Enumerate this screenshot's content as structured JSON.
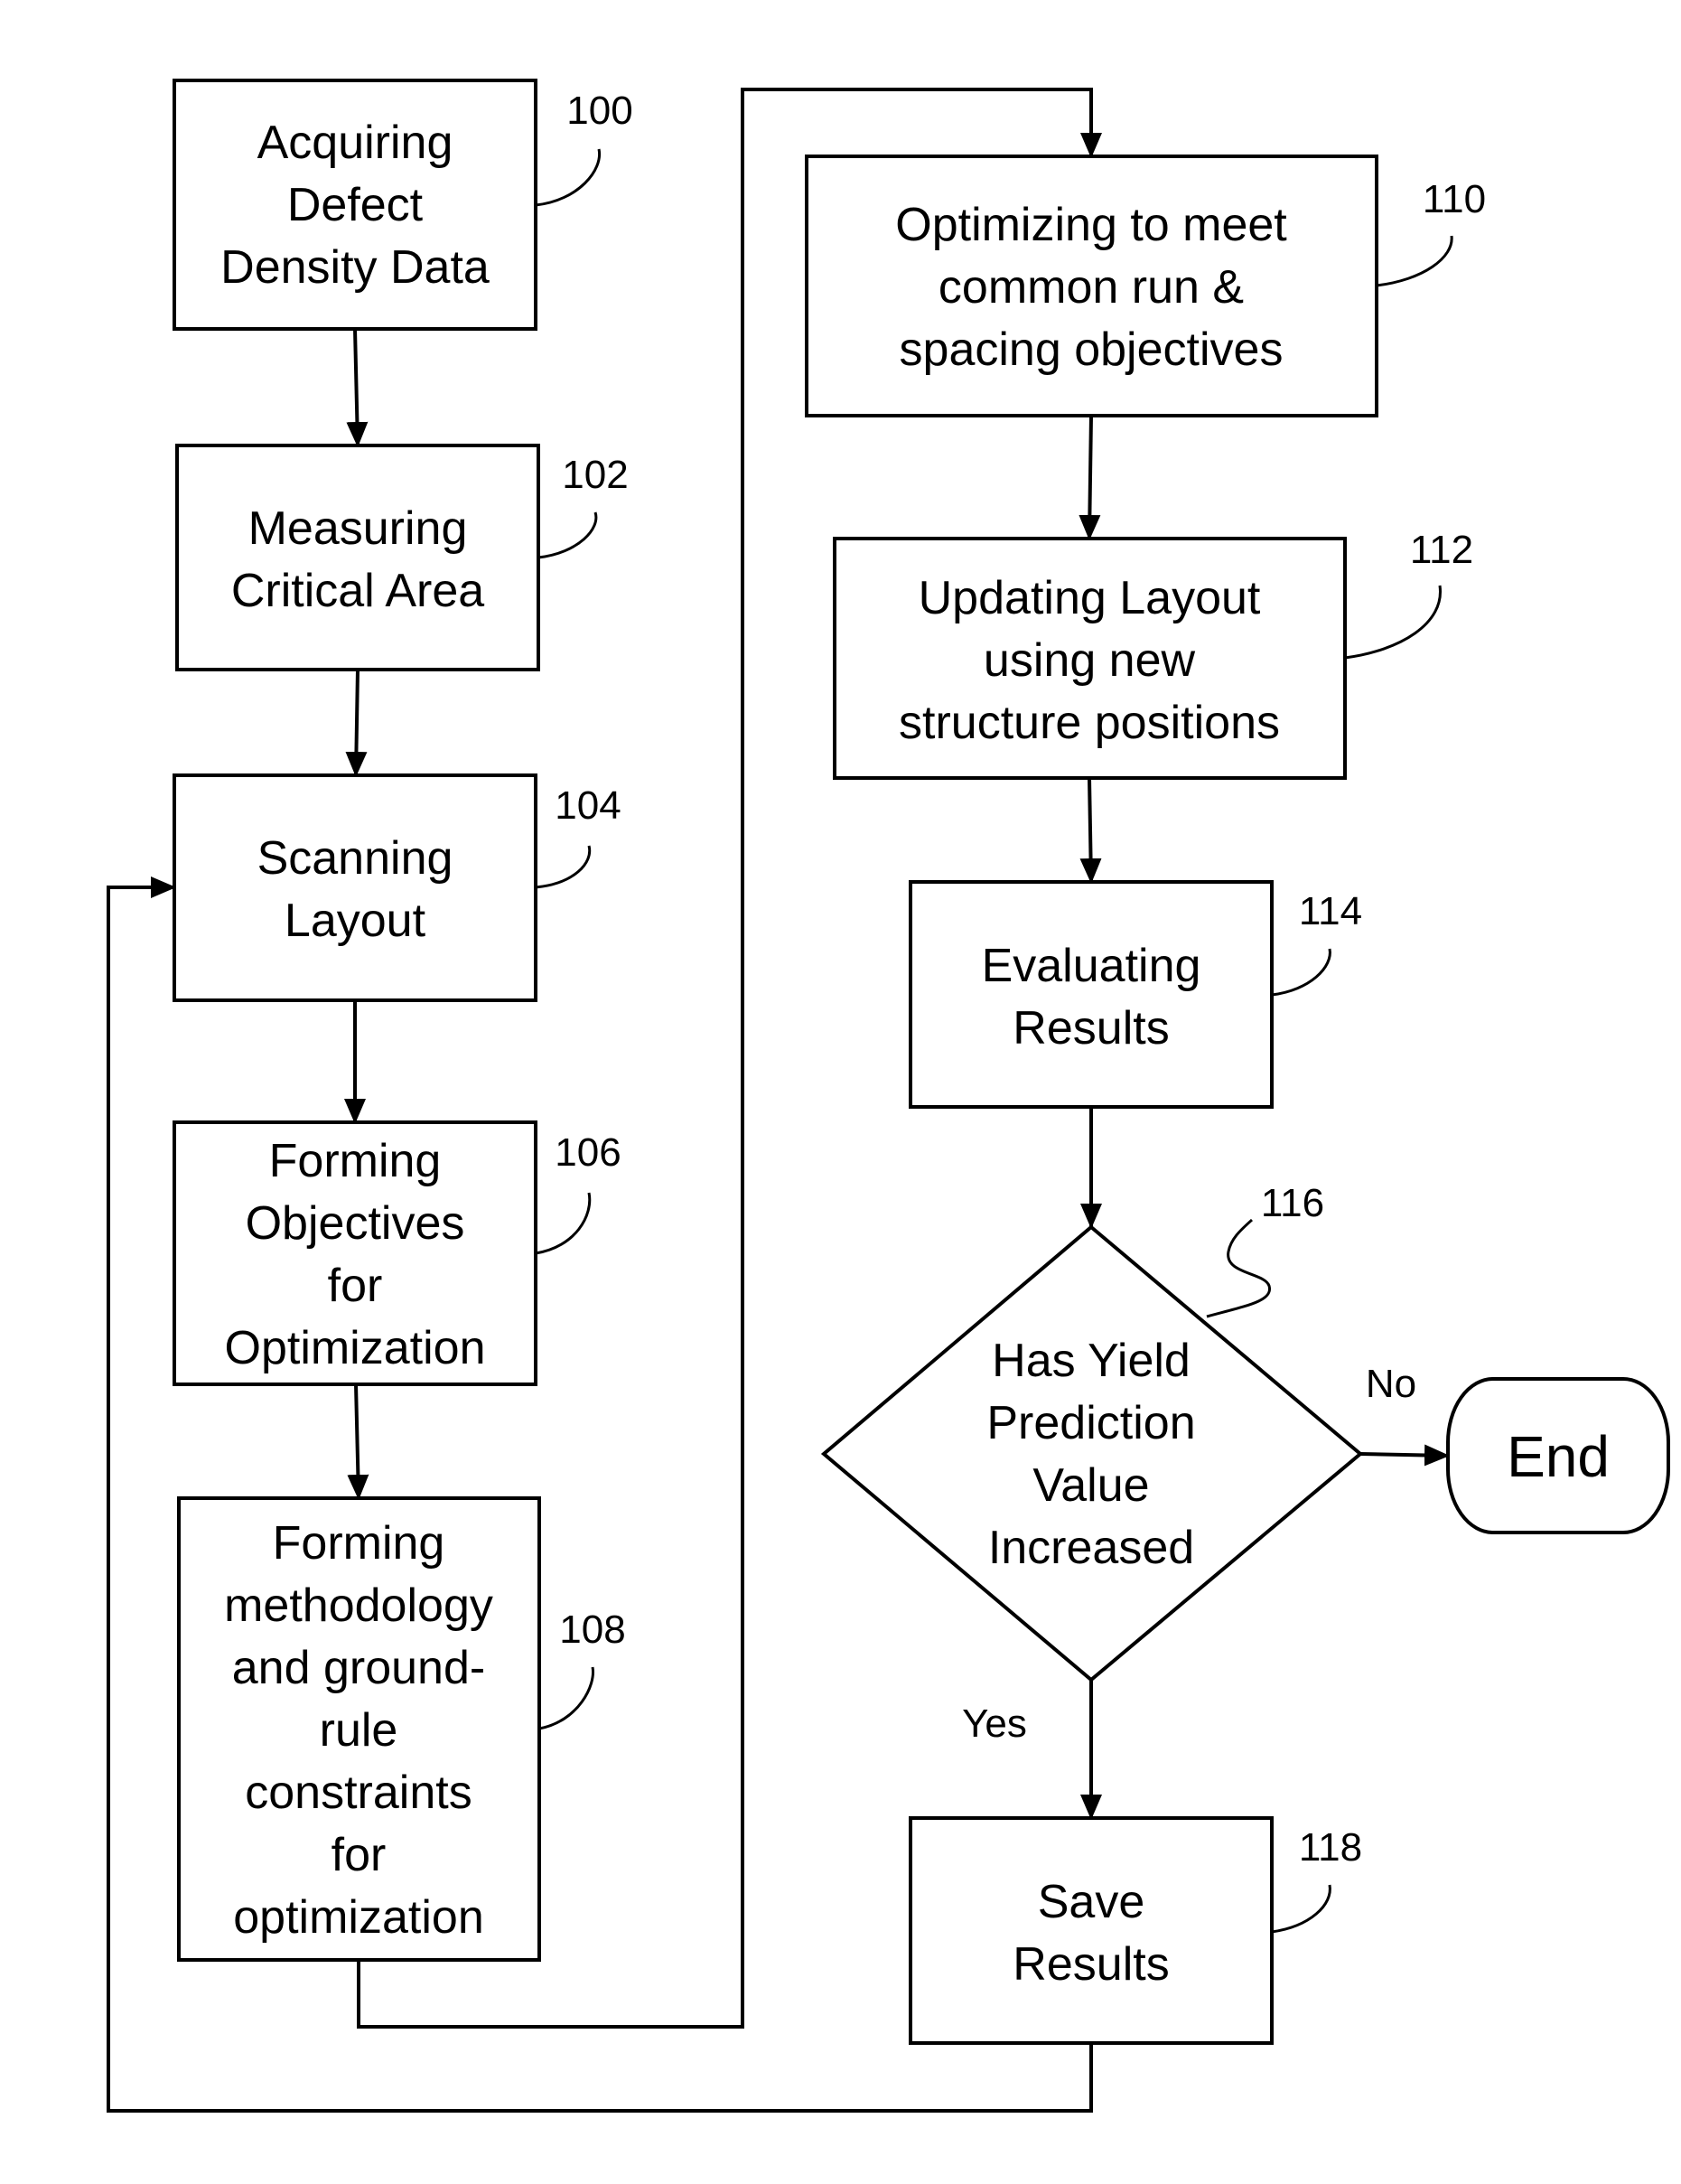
{
  "diagram": {
    "type": "flowchart",
    "steps": [
      {
        "ref": "100",
        "lines": [
          "Acquiring",
          "Defect",
          "Density Data"
        ]
      },
      {
        "ref": "102",
        "lines": [
          "Measuring",
          "Critical Area"
        ]
      },
      {
        "ref": "104",
        "lines": [
          "Scanning",
          "Layout"
        ]
      },
      {
        "ref": "106",
        "lines": [
          "Forming",
          "Objectives",
          "for",
          "Optimization"
        ]
      },
      {
        "ref": "108",
        "lines": [
          "Forming",
          "methodology",
          "and ground-",
          "rule",
          "constraints",
          "for",
          "optimization"
        ]
      },
      {
        "ref": "110",
        "lines": [
          "Optimizing to meet",
          "common run &",
          "spacing objectives"
        ]
      },
      {
        "ref": "112",
        "lines": [
          "Updating Layout",
          "using new",
          "structure positions"
        ]
      },
      {
        "ref": "114",
        "lines": [
          "Evaluating",
          "Results"
        ]
      },
      {
        "ref": "116",
        "lines": [
          "Has Yield",
          "Prediction",
          "Value",
          "Increased"
        ]
      },
      {
        "ref": "118",
        "lines": [
          "Save",
          "Results"
        ]
      }
    ],
    "terminal": {
      "label": "End"
    },
    "branches": {
      "no": "No",
      "yes": "Yes"
    }
  }
}
